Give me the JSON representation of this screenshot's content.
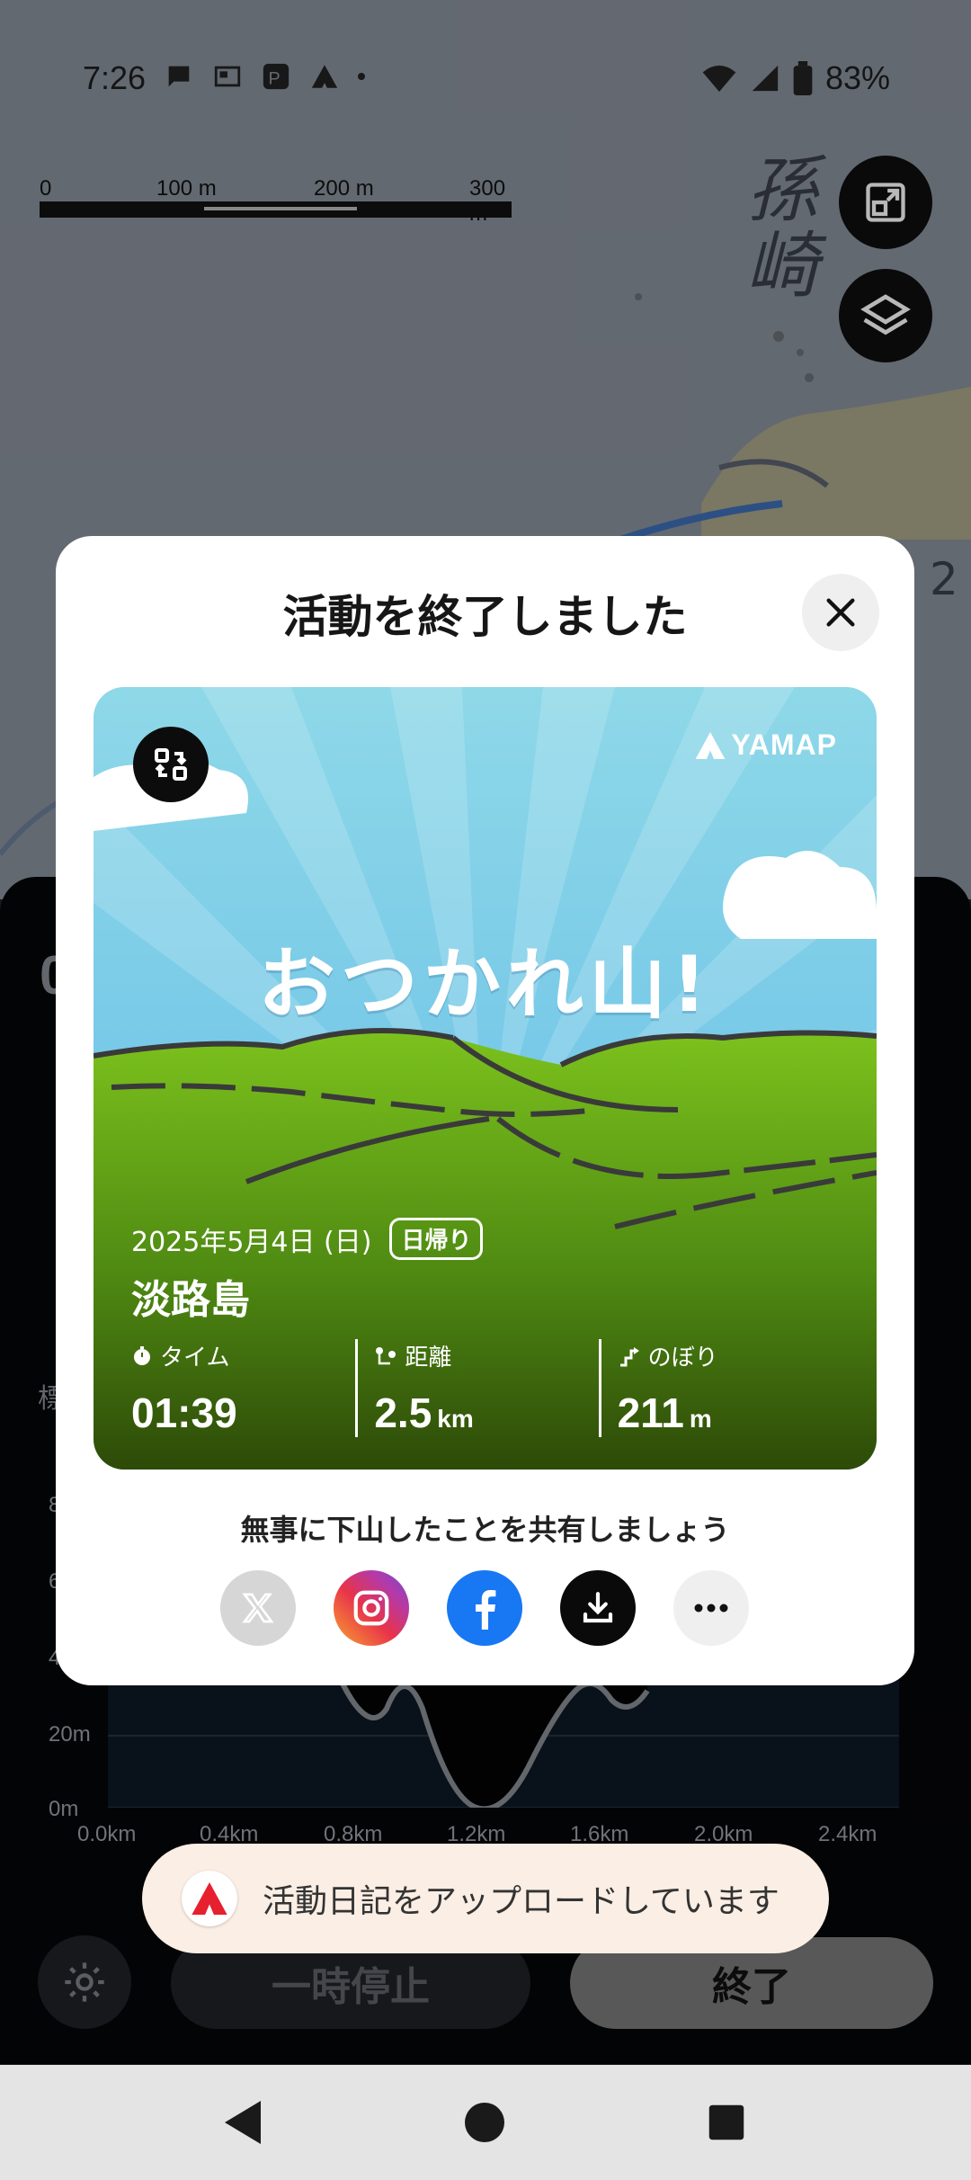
{
  "status_bar": {
    "time": "7:26",
    "battery": "83%"
  },
  "map": {
    "scale_labels": [
      "0",
      "100 m",
      "200 m",
      "300 m"
    ],
    "place_kanji": "孫崎",
    "right_edge_number": "2"
  },
  "sheet": {
    "elevation_label": "標",
    "y_ticks": [
      "8",
      "6",
      "4",
      "20m",
      "0m"
    ],
    "x_ticks": [
      "0.0km",
      "0.4km",
      "0.8km",
      "1.2km",
      "1.6km",
      "2.0km",
      "2.4km"
    ],
    "pause_label": "一時停止",
    "end_label": "終了"
  },
  "modal": {
    "title": "活動を終了しました",
    "card": {
      "brand": "YAMAP",
      "headline": "おつかれ山!",
      "date": "2025年5月4日 (日)",
      "trip_type": "日帰り",
      "place": "淡路島",
      "stats": [
        {
          "label": "タイム",
          "value": "01:39",
          "unit": ""
        },
        {
          "label": "距離",
          "value": "2.5",
          "unit": "km"
        },
        {
          "label": "のぼり",
          "value": "211",
          "unit": "m"
        }
      ]
    },
    "share_prompt": "無事に下山したことを共有しましょう"
  },
  "toast": {
    "text": "活動日記をアップロードしています"
  }
}
